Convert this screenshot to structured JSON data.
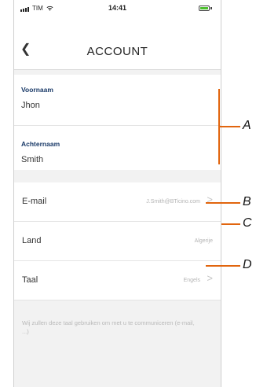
{
  "status_bar": {
    "carrier": "TIM",
    "time": "14:41",
    "battery_color": "#4cbf2e"
  },
  "nav": {
    "back_icon": "chevron-left-icon",
    "title": "ACCOUNT"
  },
  "profile": {
    "first_name_label": "Voornaam",
    "first_name_value": "Jhon",
    "last_name_label": "Achternaam",
    "last_name_value": "Smith"
  },
  "rows": {
    "email": {
      "label": "E-mail",
      "value": "J.Smith@BTicino.com",
      "chevron": ">"
    },
    "country": {
      "label": "Land",
      "value": "Algerije"
    },
    "language": {
      "label": "Taal",
      "value": "Engels",
      "chevron": ">"
    }
  },
  "note": "Wij zullen deze taal gebruiken om met u te communiceren (e-mail, ...)",
  "callouts": {
    "a": "A",
    "b": "B",
    "c": "C",
    "d": "D",
    "color": "#e1650e"
  }
}
